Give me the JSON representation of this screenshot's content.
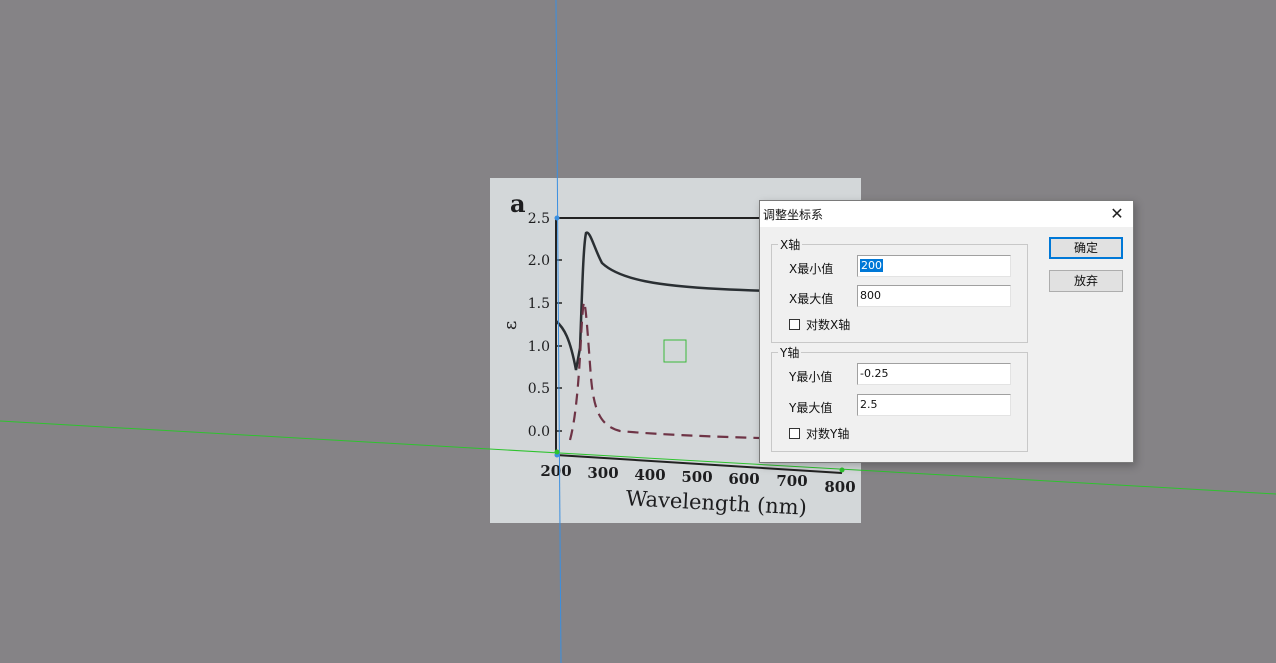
{
  "image": {
    "panel_letter": "a",
    "y_ticks": [
      "2.5",
      "2.0",
      "1.5",
      "1.0",
      "0.5",
      "0.0"
    ],
    "x_ticks": [
      "200",
      "300",
      "400",
      "500",
      "600",
      "700",
      "800"
    ],
    "y_label": "ε",
    "x_label": "Wavelength (nm)"
  },
  "dialog": {
    "title": "调整坐标系",
    "close_glyph": "✕",
    "x_group": {
      "legend": "X轴",
      "min_label": "X最小值",
      "min_value": "200",
      "max_label": "X最大值",
      "max_value": "800",
      "log_label": "对数X轴",
      "log_checked": false
    },
    "y_group": {
      "legend": "Y轴",
      "min_label": "Y最小值",
      "min_value": "-0.25",
      "max_label": "Y最大值",
      "max_value": "2.5",
      "log_label": "对数Y轴",
      "log_checked": false
    },
    "ok_label": "确定",
    "cancel_label": "放弃"
  },
  "colors": {
    "workspace": "#858386",
    "x_guide": "#2ec32e",
    "y_guide": "#3b8fe0",
    "solid_curve": "#2a2f33",
    "dashed_curve": "#6e3446"
  }
}
